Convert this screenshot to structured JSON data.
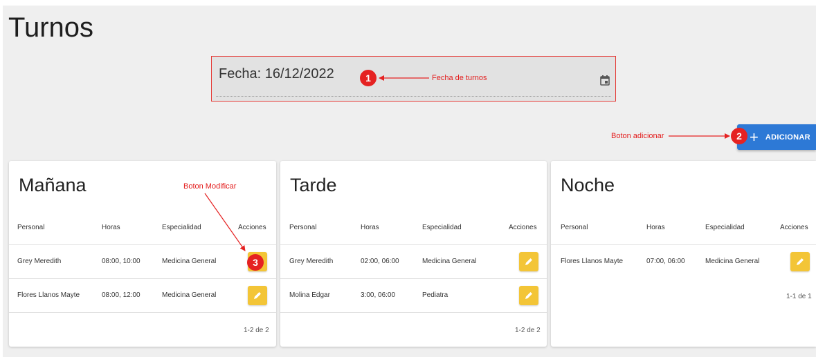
{
  "page": {
    "title": "Turnos"
  },
  "date_field": {
    "label": "Fecha: 16/12/2022"
  },
  "add_button": {
    "label": "ADICIONAR"
  },
  "annotations": {
    "m1": "1",
    "m2": "2",
    "m3": "3",
    "fecha": "Fecha de turnos",
    "adicionar": "Boton adicionar",
    "modificar": "Boton Modificar"
  },
  "headers": {
    "personal": "Personal",
    "horas": "Horas",
    "especialidad": "Especialidad",
    "acciones": "Acciones"
  },
  "shifts": [
    {
      "title": "Mañana",
      "rows": [
        {
          "personal": "Grey Meredith",
          "horas": "08:00, 10:00",
          "especialidad": "Medicina General"
        },
        {
          "personal": "Flores Llanos Mayte",
          "horas": "08:00, 12:00",
          "especialidad": "Medicina General"
        }
      ],
      "pager": "1-2 de 2"
    },
    {
      "title": "Tarde",
      "rows": [
        {
          "personal": "Grey Meredith",
          "horas": "02:00, 06:00",
          "especialidad": "Medicina General"
        },
        {
          "personal": "Molina Edgar",
          "horas": "3:00, 06:00",
          "especialidad": "Pediatra"
        }
      ],
      "pager": "1-2 de 2"
    },
    {
      "title": "Noche",
      "rows": [
        {
          "personal": "Flores Llanos Mayte",
          "horas": "07:00, 06:00",
          "especialidad": "Medicina General"
        }
      ],
      "pager": "1-1 de 1"
    }
  ],
  "colors": {
    "accent": "#2d79d6",
    "edit": "#f3c537",
    "annotation": "#e52222"
  }
}
